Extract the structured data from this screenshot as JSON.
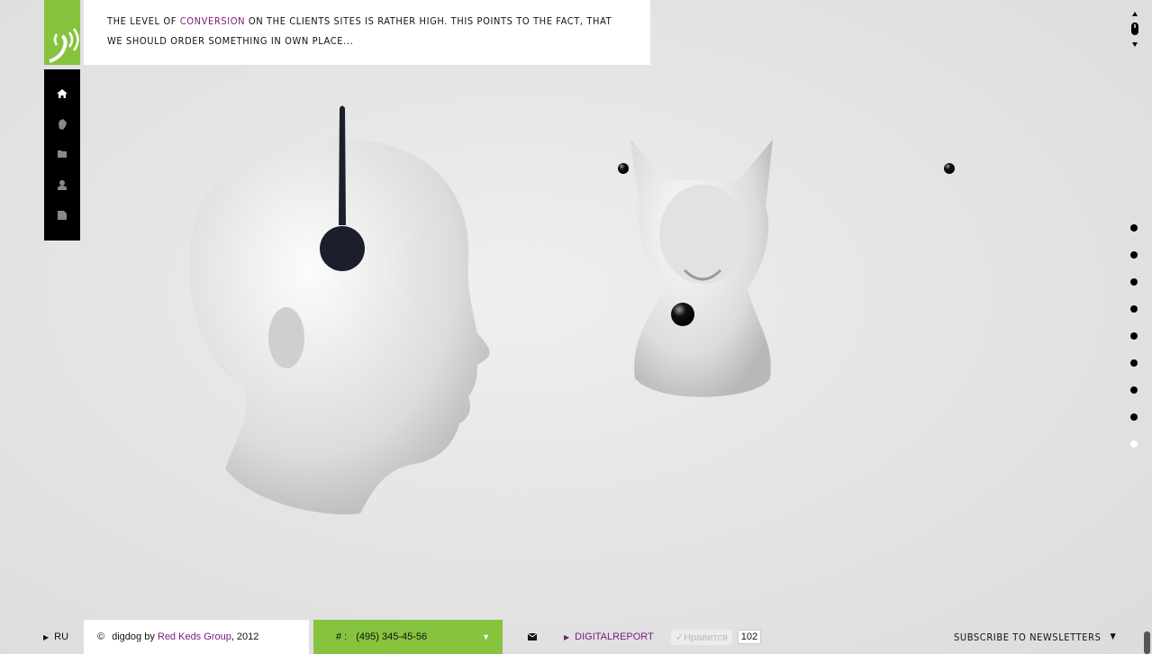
{
  "banner": {
    "pre": "The level of ",
    "highlight": "conversion",
    "post": " on the clients sites is rather high. This points to the fact, that we should order something in own place..."
  },
  "nav": {
    "items": [
      "home",
      "dog",
      "folder",
      "user",
      "document"
    ]
  },
  "slides": {
    "count": 9,
    "active_index": 8
  },
  "footer": {
    "lang": "RU",
    "copyright_symbol": "©",
    "copyright_pre": "digdog by ",
    "copyright_link": "Red Keds Group",
    "copyright_post": ", 2012",
    "phone_label": "# :",
    "phone": "(495) 345-45-56",
    "digitalreport": "DIGITALREPORT",
    "like_label": "✓Нравится",
    "like_count": "102",
    "subscribe": "SUBSCRIBE TO NEWSLETTERS"
  },
  "colors": {
    "accent": "#86c33f",
    "link": "#7a1a7a"
  }
}
